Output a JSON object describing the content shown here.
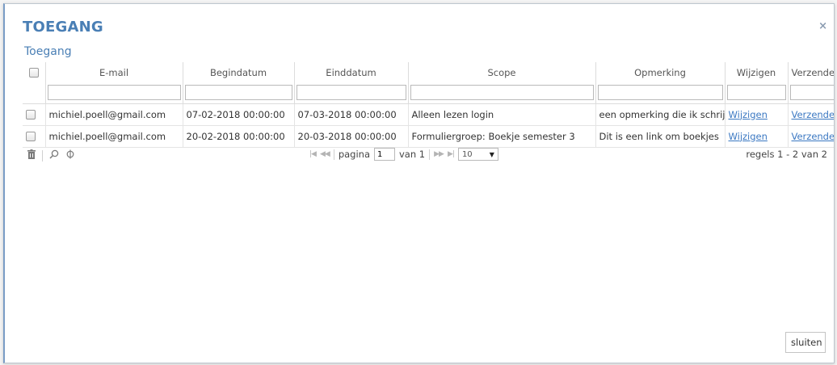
{
  "dialog": {
    "title": "TOEGANG",
    "close_glyph": "×",
    "section_title": "Toegang"
  },
  "grid": {
    "columns": [
      "E-mail",
      "Begindatum",
      "Einddatum",
      "Scope",
      "Opmerking",
      "Wijzigen",
      "Verzenden"
    ],
    "rows": [
      {
        "email": "michiel.poell@gmail.com",
        "begindatum": "07-02-2018 00:00:00",
        "einddatum": "07-03-2018 00:00:00",
        "scope": "Alleen lezen login",
        "opmerking": "een opmerking die ik schrijf",
        "wijzigen": "Wijzigen",
        "verzenden": "Verzenden"
      },
      {
        "email": "michiel.poell@gmail.com",
        "begindatum": "20-02-2018 00:00:00",
        "einddatum": "20-03-2018 00:00:00",
        "scope": "Formuliergroep: Boekje semester 3",
        "opmerking": "Dit is een link om boekjes",
        "wijzigen": "Wijzigen",
        "verzenden": "Verzenden"
      }
    ]
  },
  "pager": {
    "page_label": "pagina",
    "page_value": "1",
    "of_label": "van 1",
    "page_size": "10",
    "records_text": "regels 1 - 2 van 2",
    "icons": [
      "trash-icon",
      "search-icon",
      "refresh-icon"
    ]
  },
  "footer": {
    "close_button": "sluiten"
  }
}
